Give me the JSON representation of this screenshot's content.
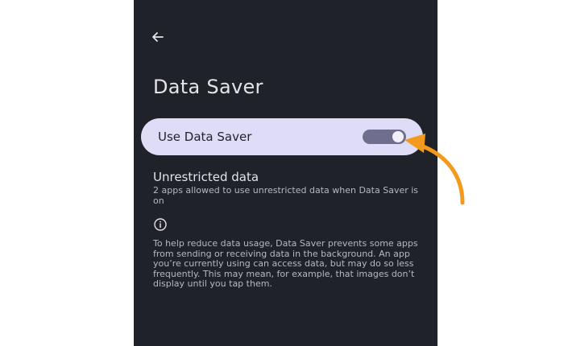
{
  "header": {
    "back_icon": "arrow-left-icon",
    "title": "Data Saver"
  },
  "data_saver_toggle": {
    "label": "Use Data Saver",
    "state": "on"
  },
  "unrestricted": {
    "title": "Unrestricted data",
    "subtitle": "2 apps allowed to use unrestricted data when Data Saver is on"
  },
  "info": {
    "icon": "info-icon",
    "text": "To help reduce data usage, Data Saver prevents some apps from sending or receiving data in the background. An app you’re currently using can access data, but may do so less frequently. This may mean, for example, that images don’t display until you tap them."
  },
  "annotation": {
    "icon": "curved-arrow-icon",
    "color": "#f39a1e"
  },
  "colors": {
    "background": "#1f2228",
    "card": "#dedcf6",
    "switch_track": "#6f6e8e",
    "arrow": "#f39a1e"
  }
}
